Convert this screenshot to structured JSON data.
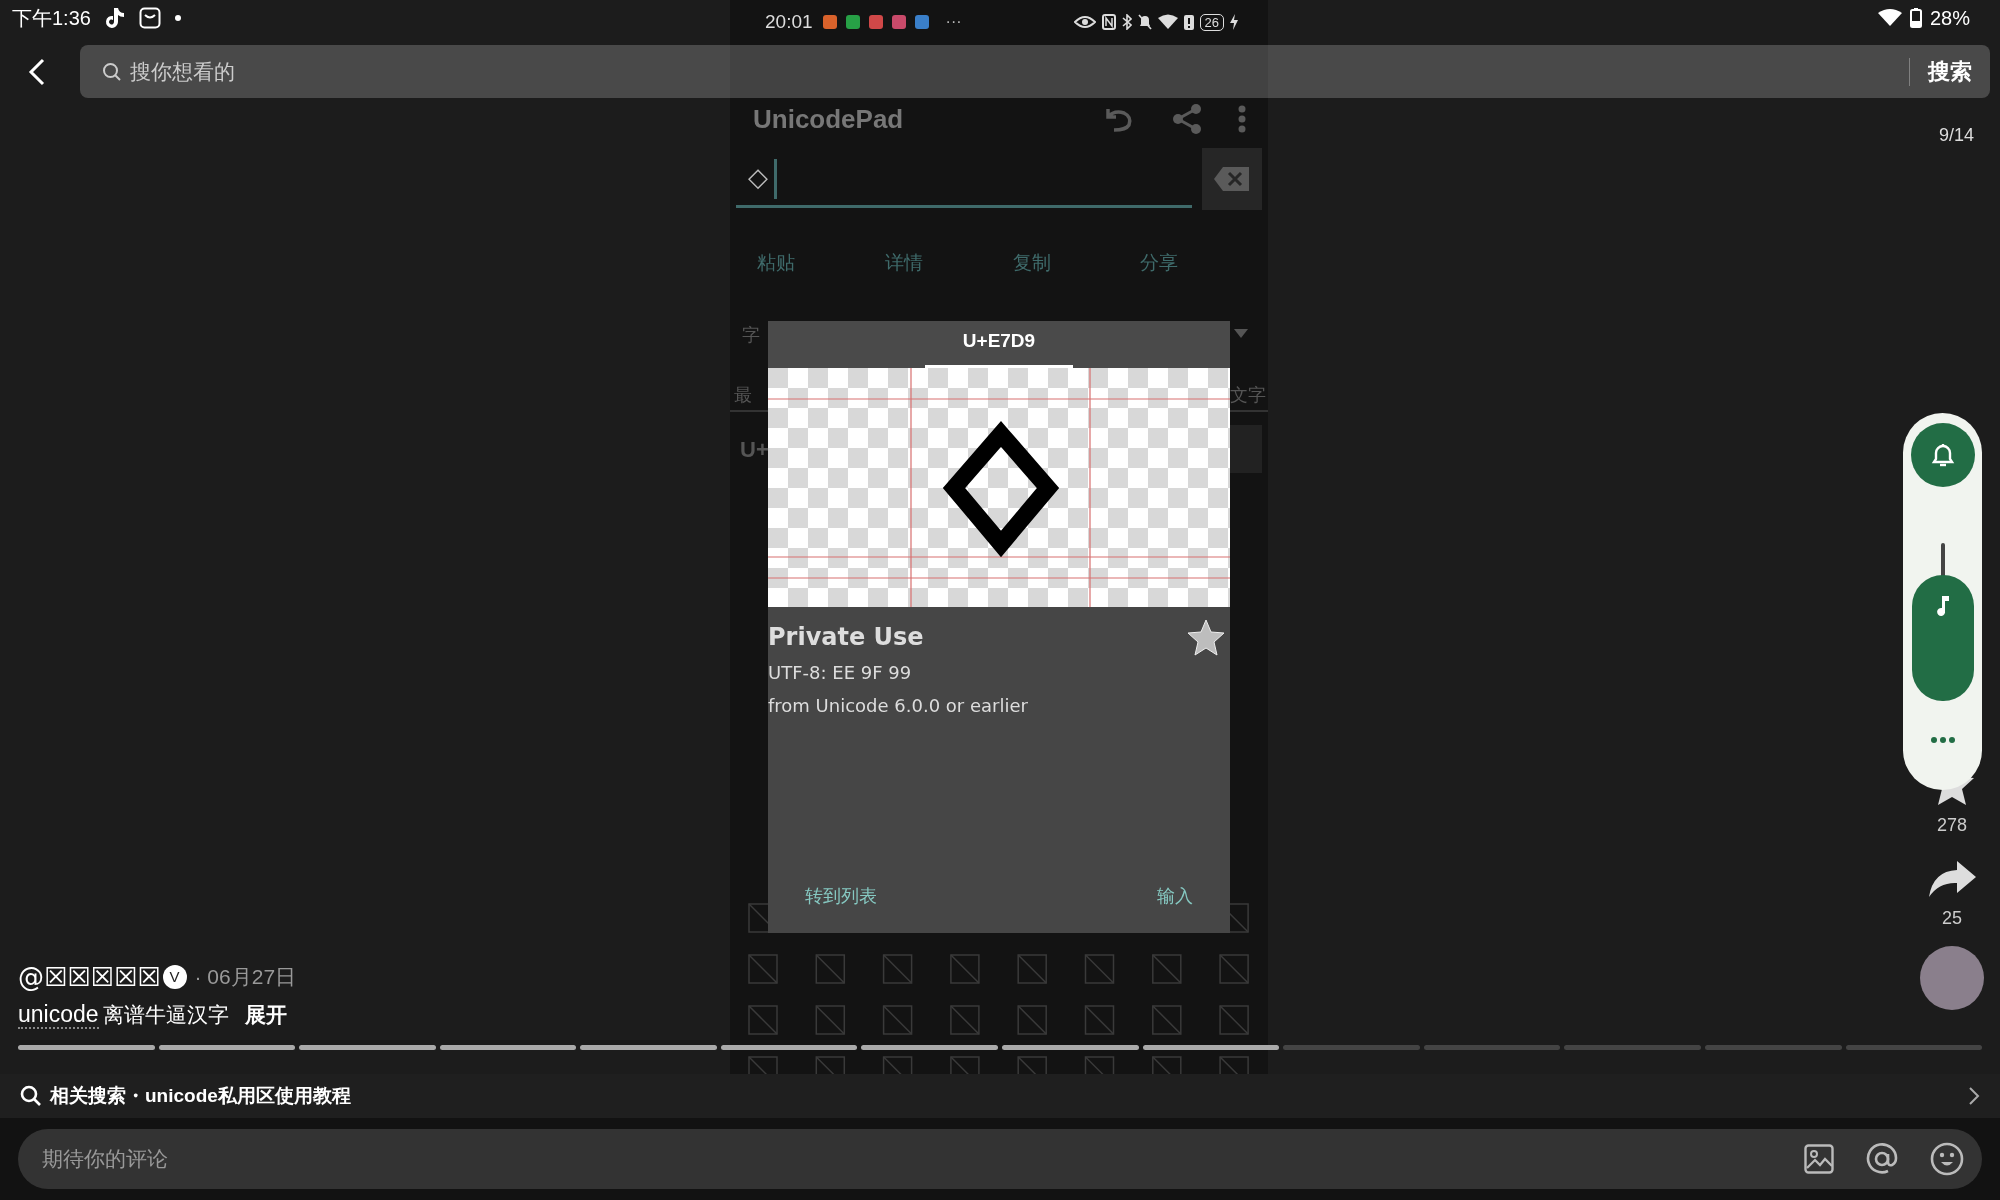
{
  "status_bar": {
    "time": "下午1:36",
    "battery": "28%"
  },
  "search": {
    "placeholder": "搜你想看的",
    "button": "搜索"
  },
  "page_counter": "9/14",
  "phone": {
    "status_bar": {
      "time": "20:01",
      "more": "···",
      "battery": "26"
    },
    "app_title": "UnicodePad",
    "input": {
      "value": "◇"
    },
    "actions": [
      "粘贴",
      "详情",
      "复制",
      "分享"
    ],
    "font_label": "字",
    "tab_left": "最",
    "tab_right": "文字",
    "code_prefix": "U+",
    "dialog": {
      "title": "U+E7D9",
      "category": "Private Use",
      "utf8": "UTF-8: EE 9F 99",
      "version": "from Unicode 6.0.0 or earlier",
      "favorite": false,
      "buttons": [
        "转到列表",
        "输入"
      ]
    }
  },
  "post": {
    "author": "@☒☒☒☒☒",
    "badge": "V",
    "date": "· 06月27日",
    "tag": "unicode",
    "text": "离谱牛逼汉字",
    "expand": "展开"
  },
  "progress": [
    {
      "seen": true
    },
    {
      "seen": true
    },
    {
      "seen": true
    },
    {
      "seen": true
    },
    {
      "seen": true
    },
    {
      "seen": true
    },
    {
      "seen": true
    },
    {
      "seen": true
    },
    {
      "seen": true
    },
    {
      "seen": false
    },
    {
      "seen": false
    },
    {
      "seen": false
    },
    {
      "seen": false
    },
    {
      "seen": false
    }
  ],
  "related": {
    "label": "相关搜索・unicode私用区使用教程"
  },
  "comment": {
    "placeholder": "期待你的评论"
  },
  "volume_panel": {
    "level": 0.8
  },
  "side": {
    "favorites": "278",
    "shares": "25"
  }
}
